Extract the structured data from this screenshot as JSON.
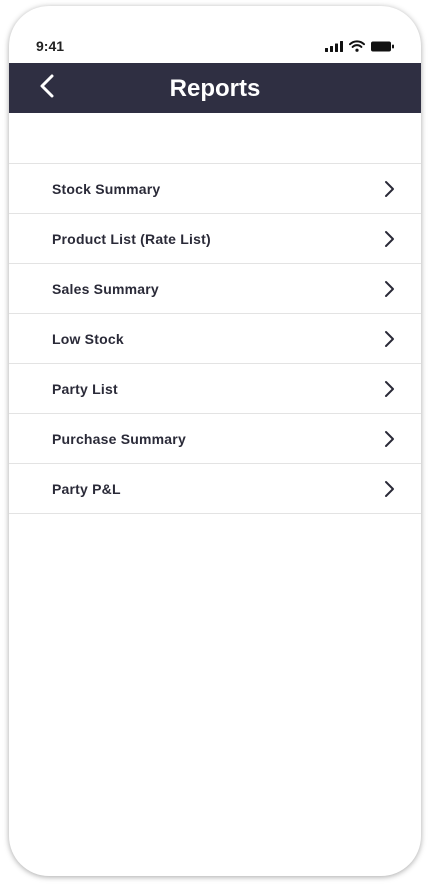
{
  "status_bar": {
    "time": "9:41",
    "icons": [
      "signal-icon",
      "wifi-icon",
      "battery-icon"
    ]
  },
  "header": {
    "title": "Reports",
    "back_icon": "chevron-left-icon",
    "background_color": "#2f2f42"
  },
  "reports": {
    "items": [
      {
        "label": "Stock Summary",
        "icon": "chevron-right-icon"
      },
      {
        "label": "Product List (Rate List)",
        "icon": "chevron-right-icon"
      },
      {
        "label": "Sales Summary",
        "icon": "chevron-right-icon"
      },
      {
        "label": "Low Stock",
        "icon": "chevron-right-icon"
      },
      {
        "label": "Party List",
        "icon": "chevron-right-icon"
      },
      {
        "label": "Purchase Summary",
        "icon": "chevron-right-icon"
      },
      {
        "label": "Party P&L",
        "icon": "chevron-right-icon"
      }
    ]
  }
}
